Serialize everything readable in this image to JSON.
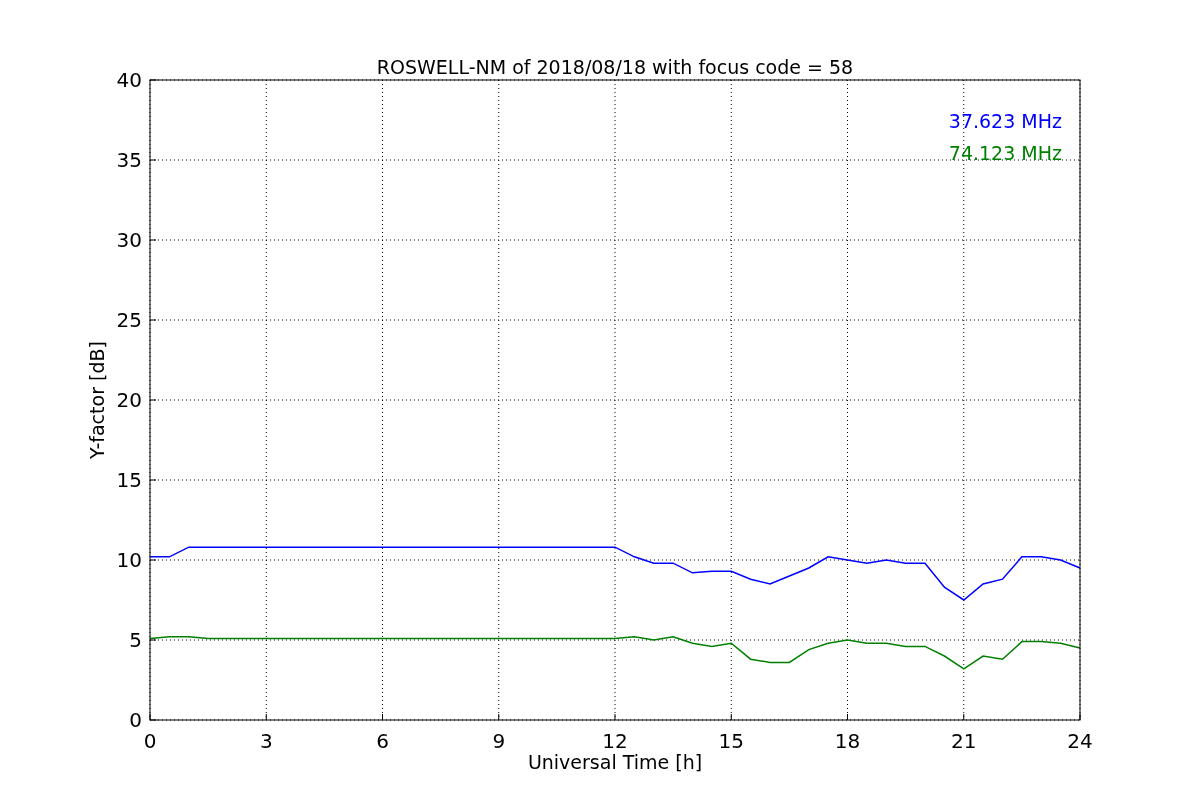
{
  "figure": {
    "chart_data": {
      "type": "line",
      "title": "ROSWELL-NM of 2018/08/18 with focus code = 58",
      "xlabel": "Universal Time [h]",
      "ylabel": "Y-factor [dB]",
      "x": [
        0,
        0.5,
        1,
        1.5,
        2,
        2.5,
        3,
        3.5,
        4,
        4.5,
        5,
        5.5,
        6,
        6.5,
        7,
        7.5,
        8,
        8.5,
        9,
        9.5,
        10,
        10.5,
        11,
        11.5,
        12,
        12.5,
        13,
        13.5,
        14,
        14.5,
        15,
        15.5,
        16,
        16.5,
        17,
        17.5,
        18,
        18.5,
        19,
        19.5,
        20,
        20.5,
        21,
        21.5,
        22,
        22.5,
        23,
        23.5,
        24
      ],
      "series": [
        {
          "name": "37.623 MHz",
          "color": "#0000ff",
          "values": [
            10.2,
            10.2,
            10.8,
            10.8,
            10.8,
            10.8,
            10.8,
            10.8,
            10.8,
            10.8,
            10.8,
            10.8,
            10.8,
            10.8,
            10.8,
            10.8,
            10.8,
            10.8,
            10.8,
            10.8,
            10.8,
            10.8,
            10.8,
            10.8,
            10.8,
            10.2,
            9.8,
            9.8,
            9.2,
            9.3,
            9.3,
            8.8,
            8.5,
            9.0,
            9.5,
            10.2,
            10.0,
            9.8,
            10.0,
            9.8,
            9.8,
            8.3,
            7.5,
            8.5,
            8.8,
            10.2,
            10.2,
            10.0,
            9.5
          ]
        },
        {
          "name": "74.123 MHz",
          "color": "#008000",
          "values": [
            5.1,
            5.2,
            5.2,
            5.1,
            5.1,
            5.1,
            5.1,
            5.1,
            5.1,
            5.1,
            5.1,
            5.1,
            5.1,
            5.1,
            5.1,
            5.1,
            5.1,
            5.1,
            5.1,
            5.1,
            5.1,
            5.1,
            5.1,
            5.1,
            5.1,
            5.2,
            5.0,
            5.2,
            4.8,
            4.6,
            4.8,
            3.8,
            3.6,
            3.6,
            4.4,
            4.8,
            5.0,
            4.8,
            4.8,
            4.6,
            4.6,
            4.0,
            3.2,
            4.0,
            3.8,
            4.9,
            4.9,
            4.8,
            4.5
          ]
        }
      ],
      "grid": true,
      "xlim": [
        0,
        24
      ],
      "ylim": [
        0,
        40
      ],
      "xticks": [
        0,
        3,
        6,
        9,
        12,
        15,
        18,
        21,
        24
      ],
      "yticks": [
        0,
        5,
        10,
        15,
        20,
        25,
        30,
        35,
        40
      ]
    }
  }
}
